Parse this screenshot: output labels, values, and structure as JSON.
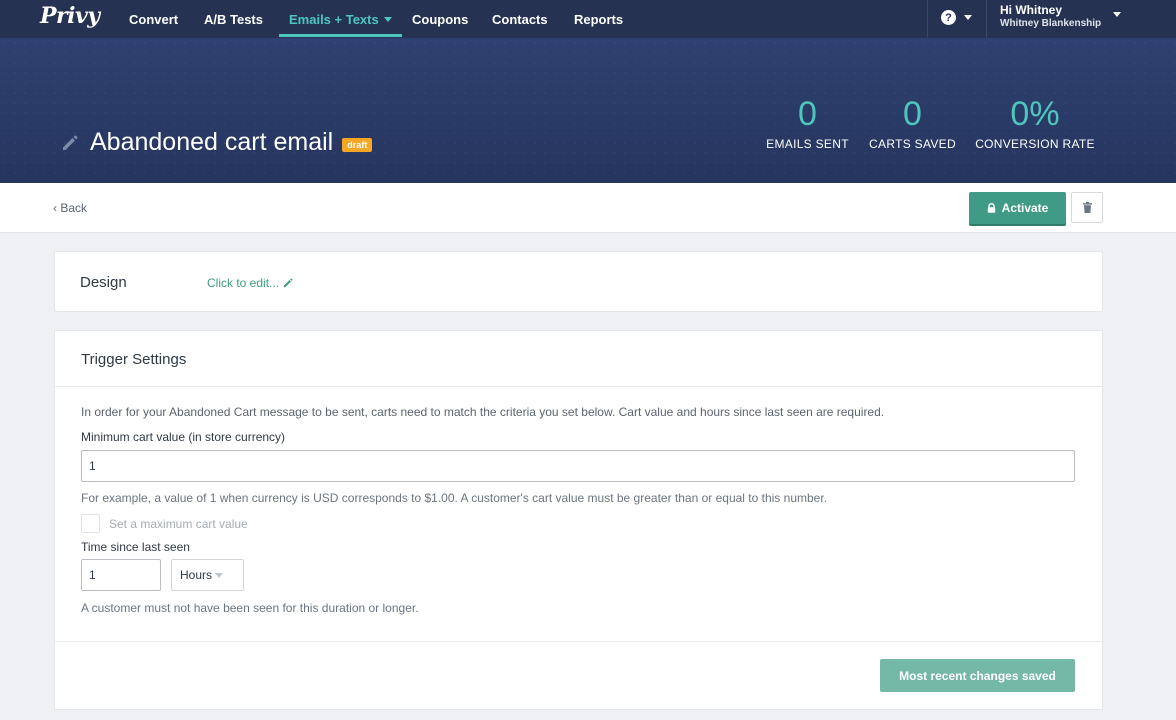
{
  "brand": {
    "logo_text": "Privy"
  },
  "nav": {
    "items": [
      {
        "label": "Convert"
      },
      {
        "label": "A/B Tests"
      },
      {
        "label": "Emails + Texts"
      },
      {
        "label": "Coupons"
      },
      {
        "label": "Contacts"
      },
      {
        "label": "Reports"
      }
    ],
    "active_index": 2,
    "help_icon": "question-circle-icon",
    "help_symbol": "?"
  },
  "user": {
    "greeting": "Hi Whitney",
    "name": "Whitney Blankenship"
  },
  "header": {
    "title": "Abandoned cart email",
    "badge": "draft",
    "stats": [
      {
        "value": "0",
        "label": "EMAILS SENT"
      },
      {
        "value": "0",
        "label": "CARTS SAVED"
      },
      {
        "value": "0%",
        "label": "CONVERSION RATE"
      }
    ]
  },
  "actions": {
    "back_label": "‹ Back",
    "activate_label": "Activate",
    "activate_icon": "lock-icon",
    "delete_icon": "trash-icon"
  },
  "design": {
    "label": "Design",
    "edit_label": "Click to edit..."
  },
  "trigger": {
    "title": "Trigger Settings",
    "intro": "In order for your Abandoned Cart message to be sent, carts need to match the criteria you set below. Cart value and hours since last seen are required.",
    "min_cart_label": "Minimum cart value (in store currency)",
    "min_cart_value": "1",
    "min_cart_help": "For example, a value of 1 when currency is USD corresponds to $1.00. A customer's cart value must be greater than or equal to this number.",
    "max_cart_checkbox_label": "Set a maximum cart value",
    "max_cart_checked": false,
    "time_label": "Time since last seen",
    "time_value": "1",
    "time_unit": "Hours",
    "time_help": "A customer must not have been seen for this duration or longer.",
    "save_status_label": "Most recent changes saved"
  },
  "colors": {
    "nav_bg": "#253252",
    "accent_teal": "#4fc6bd",
    "primary_green": "#3f9b86",
    "badge_orange": "#f5a623"
  }
}
